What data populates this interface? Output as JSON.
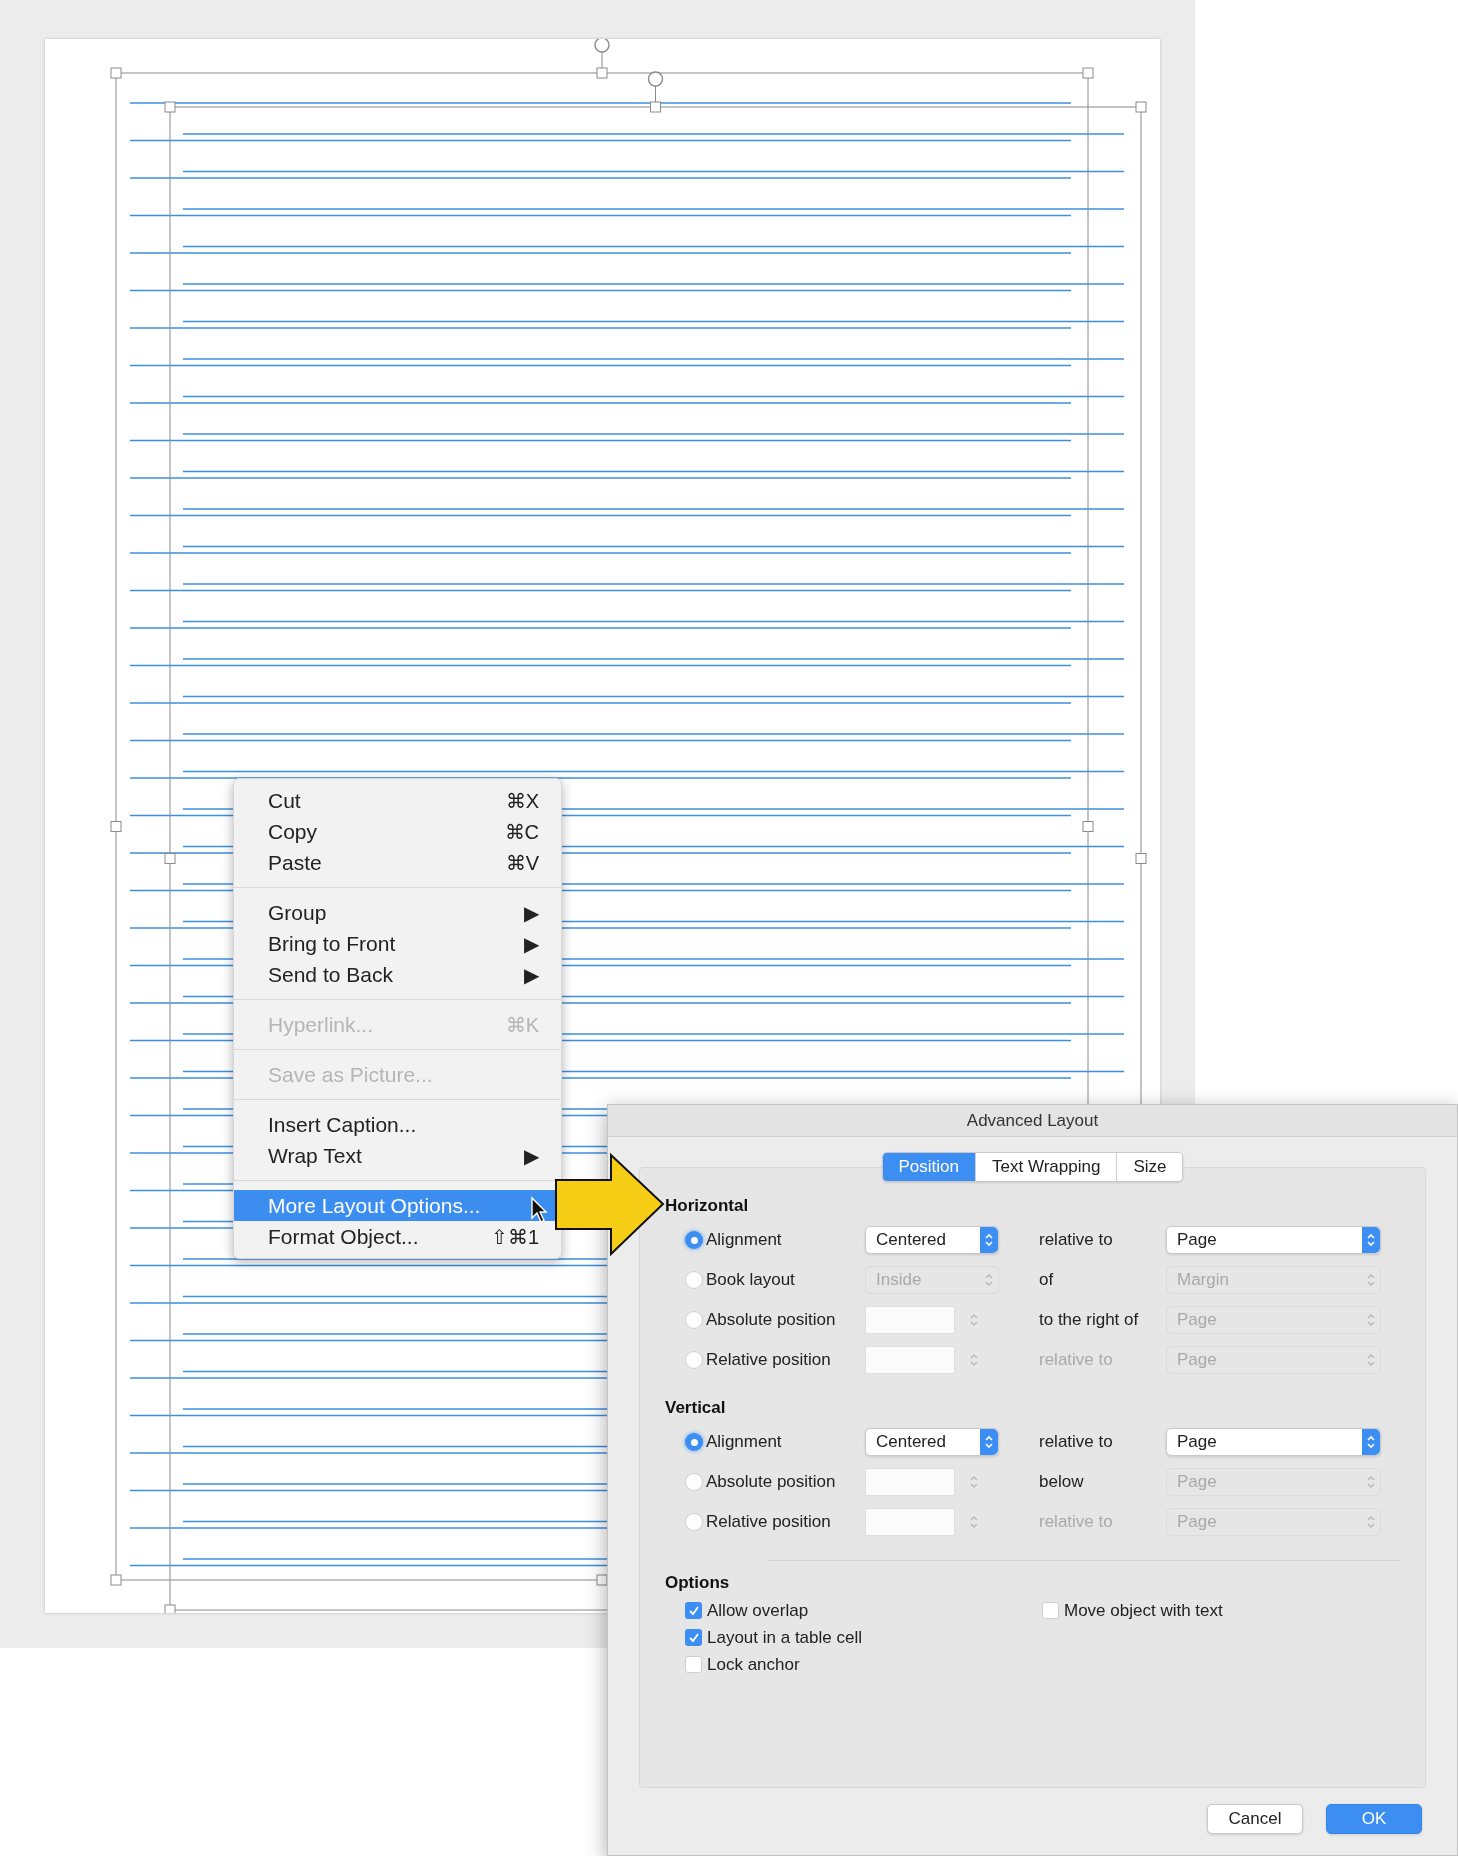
{
  "context_menu": {
    "groups": [
      {
        "items": [
          {
            "label": "Cut",
            "shortcut": "⌘X",
            "disabled": false,
            "selected": false
          },
          {
            "label": "Copy",
            "shortcut": "⌘C",
            "disabled": false,
            "selected": false
          },
          {
            "label": "Paste",
            "shortcut": "⌘V",
            "disabled": false,
            "selected": false
          }
        ]
      },
      {
        "items": [
          {
            "label": "Group",
            "shortcut": "▶",
            "disabled": false,
            "selected": false
          },
          {
            "label": "Bring to Front",
            "shortcut": "▶",
            "disabled": false,
            "selected": false
          },
          {
            "label": "Send to Back",
            "shortcut": "▶",
            "disabled": false,
            "selected": false
          }
        ]
      },
      {
        "items": [
          {
            "label": "Hyperlink...",
            "shortcut": "⌘K",
            "disabled": true,
            "selected": false
          }
        ]
      },
      {
        "items": [
          {
            "label": "Save as Picture...",
            "disabled": true,
            "selected": false
          }
        ]
      },
      {
        "items": [
          {
            "label": "Insert Caption...",
            "disabled": false,
            "selected": false
          },
          {
            "label": "Wrap Text",
            "shortcut": "▶",
            "disabled": false,
            "selected": false
          }
        ]
      },
      {
        "items": [
          {
            "label": "More Layout Options...",
            "disabled": false,
            "selected": true
          },
          {
            "label": "Format Object...",
            "shortcut": "⇧⌘1",
            "disabled": false,
            "selected": false
          }
        ]
      }
    ]
  },
  "dialog": {
    "title": "Advanced Layout",
    "tabs": [
      {
        "label": "Position",
        "selected": true
      },
      {
        "label": "Text Wrapping",
        "selected": false
      },
      {
        "label": "Size",
        "selected": false
      }
    ],
    "sections": [
      {
        "heading": "Horizontal",
        "rows": [
          {
            "label": "Alignment",
            "selected": true,
            "control": {
              "kind": "select",
              "value": "Centered",
              "disabled": false
            },
            "relation": {
              "text": "relative to",
              "disabled": false
            },
            "target": {
              "value": "Page",
              "disabled": false
            }
          },
          {
            "label": "Book layout",
            "selected": false,
            "control": {
              "kind": "select",
              "value": "Inside",
              "disabled": true
            },
            "relation": {
              "text": "of",
              "disabled": false
            },
            "target": {
              "value": "Margin",
              "disabled": true
            }
          },
          {
            "label": "Absolute position",
            "selected": false,
            "control": {
              "kind": "number",
              "disabled": true
            },
            "relation": {
              "text": "to the right of",
              "disabled": false
            },
            "target": {
              "value": "Page",
              "disabled": true
            }
          },
          {
            "label": "Relative position",
            "selected": false,
            "control": {
              "kind": "number",
              "disabled": true
            },
            "relation": {
              "text": "relative to",
              "disabled": true
            },
            "target": {
              "value": "Page",
              "disabled": true
            }
          }
        ]
      },
      {
        "heading": "Vertical",
        "rows": [
          {
            "label": "Alignment",
            "selected": true,
            "control": {
              "kind": "select",
              "value": "Centered",
              "disabled": false
            },
            "relation": {
              "text": "relative to",
              "disabled": false
            },
            "target": {
              "value": "Page",
              "disabled": false
            }
          },
          {
            "label": "Absolute position",
            "selected": false,
            "control": {
              "kind": "number",
              "disabled": true
            },
            "relation": {
              "text": "below",
              "disabled": false
            },
            "target": {
              "value": "Page",
              "disabled": true
            }
          },
          {
            "label": "Relative position",
            "selected": false,
            "control": {
              "kind": "number",
              "disabled": true
            },
            "relation": {
              "text": "relative to",
              "disabled": true
            },
            "target": {
              "value": "Page",
              "disabled": true
            }
          }
        ]
      }
    ],
    "options": {
      "heading": "Options",
      "columns": [
        [
          {
            "label": "Allow overlap",
            "checked": true
          },
          {
            "label": "Layout in a table cell",
            "checked": true
          },
          {
            "label": "Lock anchor",
            "checked": false
          }
        ],
        [
          {
            "label": "Move object with text",
            "checked": false
          }
        ]
      ]
    },
    "buttons": [
      {
        "label": "Cancel",
        "kind": "secondary"
      },
      {
        "label": "OK",
        "kind": "primary"
      }
    ]
  }
}
